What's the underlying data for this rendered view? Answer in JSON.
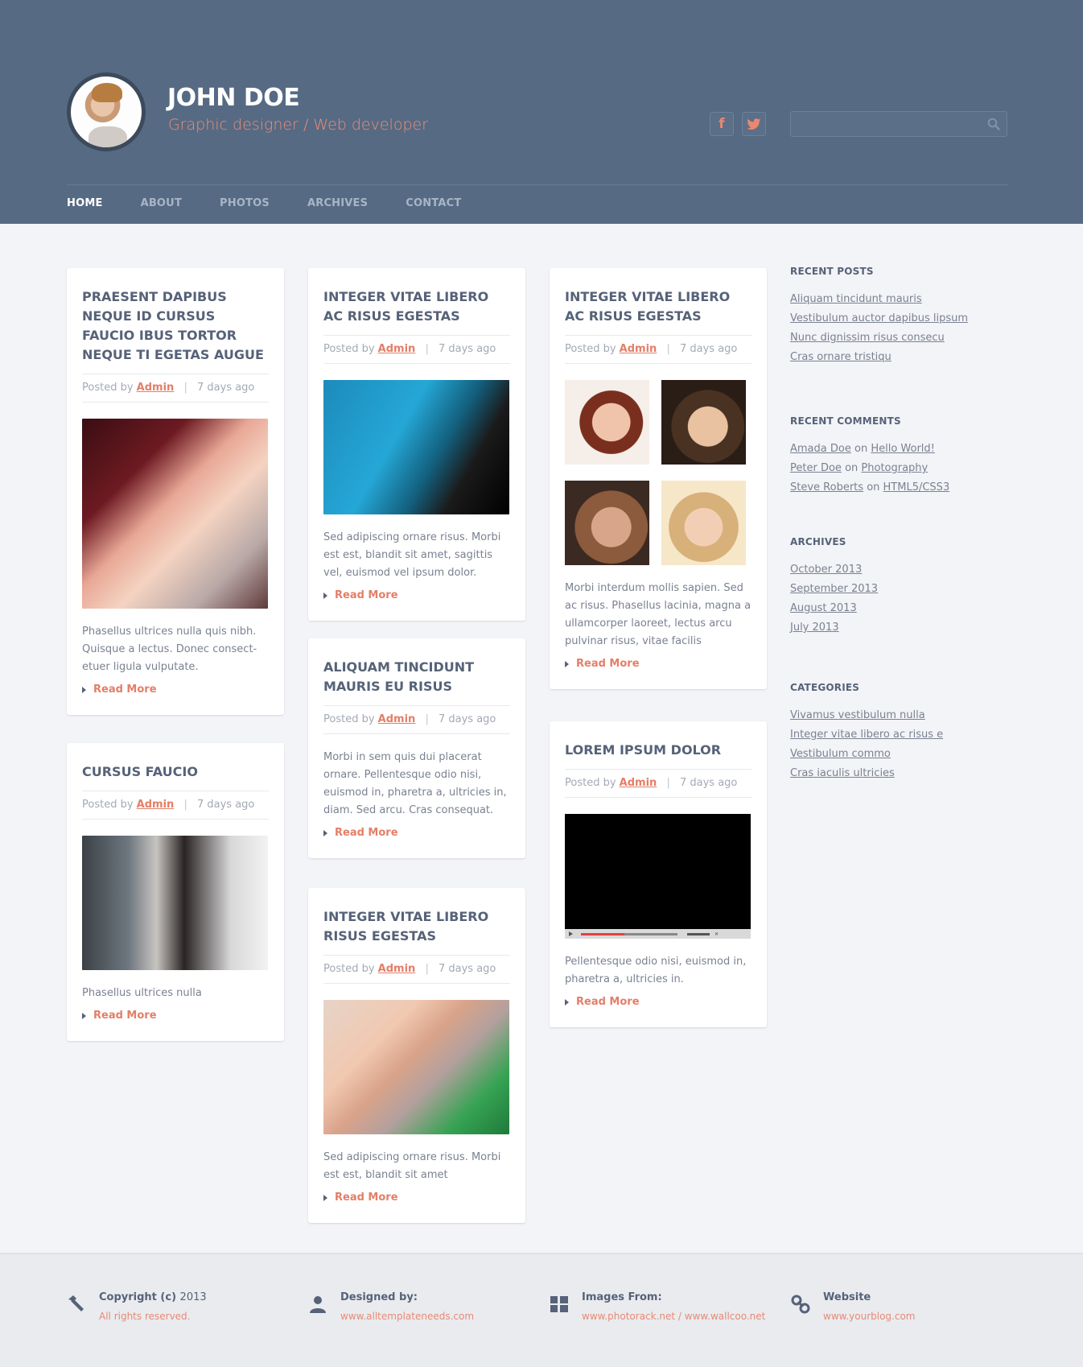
{
  "profile": {
    "name": "JOHN DOE",
    "tagline": "Graphic designer / Web developer",
    "avatar_icon": "profile-photo"
  },
  "social": {
    "facebook_glyph": "f",
    "twitter_icon": "twitter-bird-icon"
  },
  "search": {
    "value": "",
    "placeholder": ""
  },
  "nav": {
    "items": [
      {
        "label": "HOME",
        "active": true
      },
      {
        "label": "ABOUT",
        "active": false
      },
      {
        "label": "PHOTOS",
        "active": false
      },
      {
        "label": "ARCHIVES",
        "active": false
      },
      {
        "label": "CONTACT",
        "active": false
      }
    ]
  },
  "posts": [
    {
      "title": "PRAESENT DAPIBUS NEQUE ID CURSUS FAUCIO IBUS TORTOR NEQUE TI EGETAS AUGUE",
      "posted_by": "Posted by",
      "author": "Admin",
      "sep": "|",
      "time": "7 days ago",
      "excerpt": "Phasellus ultrices nulla quis nibh. Quisque a lectus. Donec consect-etuer ligula vulputate.",
      "read_more": "Read More"
    },
    {
      "title": "CURSUS FAUCIO",
      "posted_by": "Posted by",
      "author": "Admin",
      "sep": "|",
      "time": "7 days ago",
      "excerpt": "Phasellus ultrices nulla",
      "read_more": "Read More"
    },
    {
      "title": "INTEGER VITAE LIBERO AC RISUS EGESTAS",
      "posted_by": "Posted by",
      "author": "Admin",
      "sep": "|",
      "time": "7 days ago",
      "excerpt": "Sed adipiscing ornare risus. Morbi est est, blandit sit amet, sagittis vel, euismod vel ipsum dolor.",
      "read_more": "Read More"
    },
    {
      "title": "ALIQUAM TINCIDUNT MAURIS EU RISUS",
      "posted_by": "Posted by",
      "author": "Admin",
      "sep": "|",
      "time": "7 days ago",
      "excerpt": "Morbi in sem quis dui placerat ornare. Pellentesque odio nisi, euismod in, pharetra a, ultricies in, diam. Sed arcu. Cras consequat.",
      "read_more": "Read More"
    },
    {
      "title": "INTEGER VITAE LIBERO RISUS EGESTAS",
      "posted_by": "Posted by",
      "author": "Admin",
      "sep": "|",
      "time": "7 days ago",
      "excerpt": "Sed adipiscing ornare risus. Morbi est est, blandit sit amet",
      "read_more": "Read More"
    },
    {
      "title": "INTEGER VITAE LIBERO AC RISUS EGESTAS",
      "posted_by": "Posted by",
      "author": "Admin",
      "sep": "|",
      "time": "7 days ago",
      "excerpt": "Morbi interdum mollis sapien. Sed ac risus. Phasellus lacinia, magna a ullamcorper laoreet, lectus arcu pulvinar risus, vitae facilis",
      "read_more": "Read More"
    },
    {
      "title": "LOREM IPSUM DOLOR",
      "posted_by": "Posted by",
      "author": "Admin",
      "sep": "|",
      "time": "7 days ago",
      "excerpt": "Pellentesque odio nisi, euismod in, pharetra a, ultricies in.",
      "read_more": "Read More",
      "video_progress": 0.45
    }
  ],
  "sidebar": {
    "recent_posts": {
      "heading": "RECENT POSTS",
      "items": [
        "Aliquam tincidunt mauris",
        "Vestibulum auctor dapibus  lipsum",
        "Nunc dignissim risus consecu",
        "Cras ornare tristiqu"
      ]
    },
    "recent_comments": {
      "heading": "RECENT COMMENTS",
      "items": [
        {
          "user": "Amada Doe",
          "on": "on",
          "post": "Hello World!"
        },
        {
          "user": "Peter Doe",
          "on": "on",
          "post": "Photography"
        },
        {
          "user": "Steve Roberts",
          "on": "on",
          "post": "HTML5/CSS3"
        }
      ]
    },
    "archives": {
      "heading": "ARCHIVES",
      "items": [
        "October 2013",
        "September 2013",
        "August 2013",
        "July 2013"
      ]
    },
    "categories": {
      "heading": "CATEGORIES",
      "items": [
        "Vivamus vestibulum nulla",
        "Integer vitae libero ac risus e",
        "Vestibulum commo",
        "Cras iaculis ultricies"
      ]
    }
  },
  "footer": {
    "copyright": {
      "label": "Copyright (c)",
      "year": "2013",
      "sub": "All rights reserved.",
      "icon": "hammer-icon"
    },
    "designed": {
      "label": "Designed by:",
      "sub": "www.alltemplateneeds.com",
      "icon": "user-icon"
    },
    "images": {
      "label": "Images From:",
      "sub": "www.photorack.net / www.wallcoo.net",
      "icon": "grid-icon"
    },
    "website": {
      "label": "Website",
      "sub": "www.yourblog.com",
      "icon": "link-icon"
    }
  },
  "colors": {
    "header_bg": "#566a83",
    "accent": "#e47e67",
    "page_bg": "#f3f4f7",
    "heading": "#566278"
  }
}
